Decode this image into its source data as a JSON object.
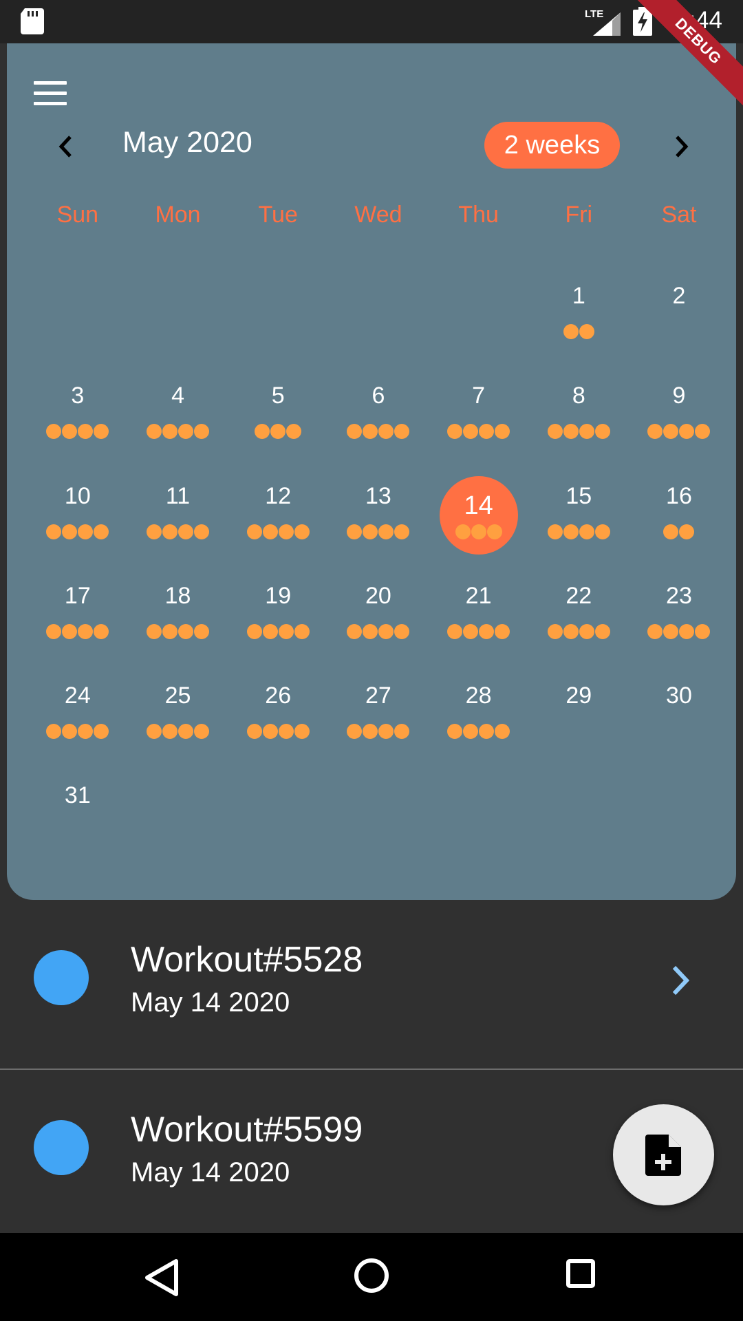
{
  "status_bar": {
    "time": "11:44",
    "network": "LTE",
    "debug_label": "DEBUG"
  },
  "calendar": {
    "month_title": "May 2020",
    "format_button_label": "2 weeks",
    "weekdays": [
      "Sun",
      "Mon",
      "Tue",
      "Wed",
      "Thu",
      "Fri",
      "Sat"
    ],
    "leading_blank_days": 5,
    "selected_day": 14,
    "accent_color": "#ff7043",
    "marker_color": "#ffa040",
    "days": [
      {
        "d": "1",
        "m": 2
      },
      {
        "d": "2",
        "m": 0
      },
      {
        "d": "3",
        "m": 4
      },
      {
        "d": "4",
        "m": 4
      },
      {
        "d": "5",
        "m": 3
      },
      {
        "d": "6",
        "m": 4
      },
      {
        "d": "7",
        "m": 4
      },
      {
        "d": "8",
        "m": 4
      },
      {
        "d": "9",
        "m": 4
      },
      {
        "d": "10",
        "m": 4
      },
      {
        "d": "11",
        "m": 4
      },
      {
        "d": "12",
        "m": 4
      },
      {
        "d": "13",
        "m": 4
      },
      {
        "d": "14",
        "m": 3
      },
      {
        "d": "15",
        "m": 4
      },
      {
        "d": "16",
        "m": 2
      },
      {
        "d": "17",
        "m": 4
      },
      {
        "d": "18",
        "m": 4
      },
      {
        "d": "19",
        "m": 4
      },
      {
        "d": "20",
        "m": 4
      },
      {
        "d": "21",
        "m": 4
      },
      {
        "d": "22",
        "m": 4
      },
      {
        "d": "23",
        "m": 4
      },
      {
        "d": "24",
        "m": 4
      },
      {
        "d": "25",
        "m": 4
      },
      {
        "d": "26",
        "m": 4
      },
      {
        "d": "27",
        "m": 4
      },
      {
        "d": "28",
        "m": 4
      },
      {
        "d": "29",
        "m": 0
      },
      {
        "d": "30",
        "m": 0
      },
      {
        "d": "31",
        "m": 0
      }
    ]
  },
  "events": [
    {
      "title": "Workout#5528",
      "date": "May 14 2020"
    },
    {
      "title": "Workout#5599",
      "date": "May 14 2020"
    }
  ],
  "fab": {
    "icon": "note-add-icon"
  },
  "nav": {
    "back_icon": "back-triangle-icon",
    "home_icon": "home-circle-icon",
    "recents_icon": "recents-square-icon"
  }
}
